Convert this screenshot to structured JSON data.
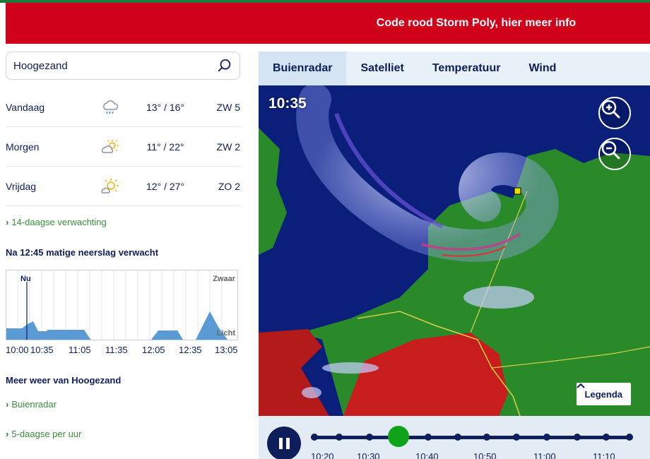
{
  "banner": {
    "text": "Code rood Storm Poly, hier meer info"
  },
  "search": {
    "value": "Hoogezand",
    "icon": "search-icon"
  },
  "forecast": [
    {
      "day": "Vandaag",
      "icon": "rain-cloud-icon",
      "temp": "13° / 16°",
      "wind": "ZW 5"
    },
    {
      "day": "Morgen",
      "icon": "partly-sunny-icon",
      "temp": "11° / 22°",
      "wind": "ZW 2"
    },
    {
      "day": "Vrijdag",
      "icon": "partly-sunny-icon",
      "temp": "12° / 27°",
      "wind": "ZO 2"
    }
  ],
  "links": {
    "fourteen_day": "14-daagse verwachting",
    "buienradar": "Buienradar",
    "five_day": "5-daagse per uur"
  },
  "precipitation": {
    "heading": "Na 12:45 matige neerslag verwacht",
    "now_label": "Nu",
    "heavy_label": "Zwaar",
    "light_label": "Licht",
    "times": [
      "10:00",
      "10:35",
      "11:05",
      "11:35",
      "12:05",
      "12:35",
      "13:05"
    ]
  },
  "more_weather": {
    "heading": "Meer weer van Hoogezand"
  },
  "radar": {
    "tabs": [
      "Buienradar",
      "Satelliet",
      "Temperatuur",
      "Wind"
    ],
    "active_tab": "Buienradar",
    "timestamp": "10:35",
    "legend_label": "Legenda",
    "timeline_labels": [
      "10:20",
      "10:30",
      "10:40",
      "10:50",
      "11:00",
      "11:10"
    ],
    "colors": {
      "sea": "#0a1f7a",
      "land": "#2a8a2a",
      "active": "#0fa31a",
      "brand": "#d0021b"
    }
  }
}
